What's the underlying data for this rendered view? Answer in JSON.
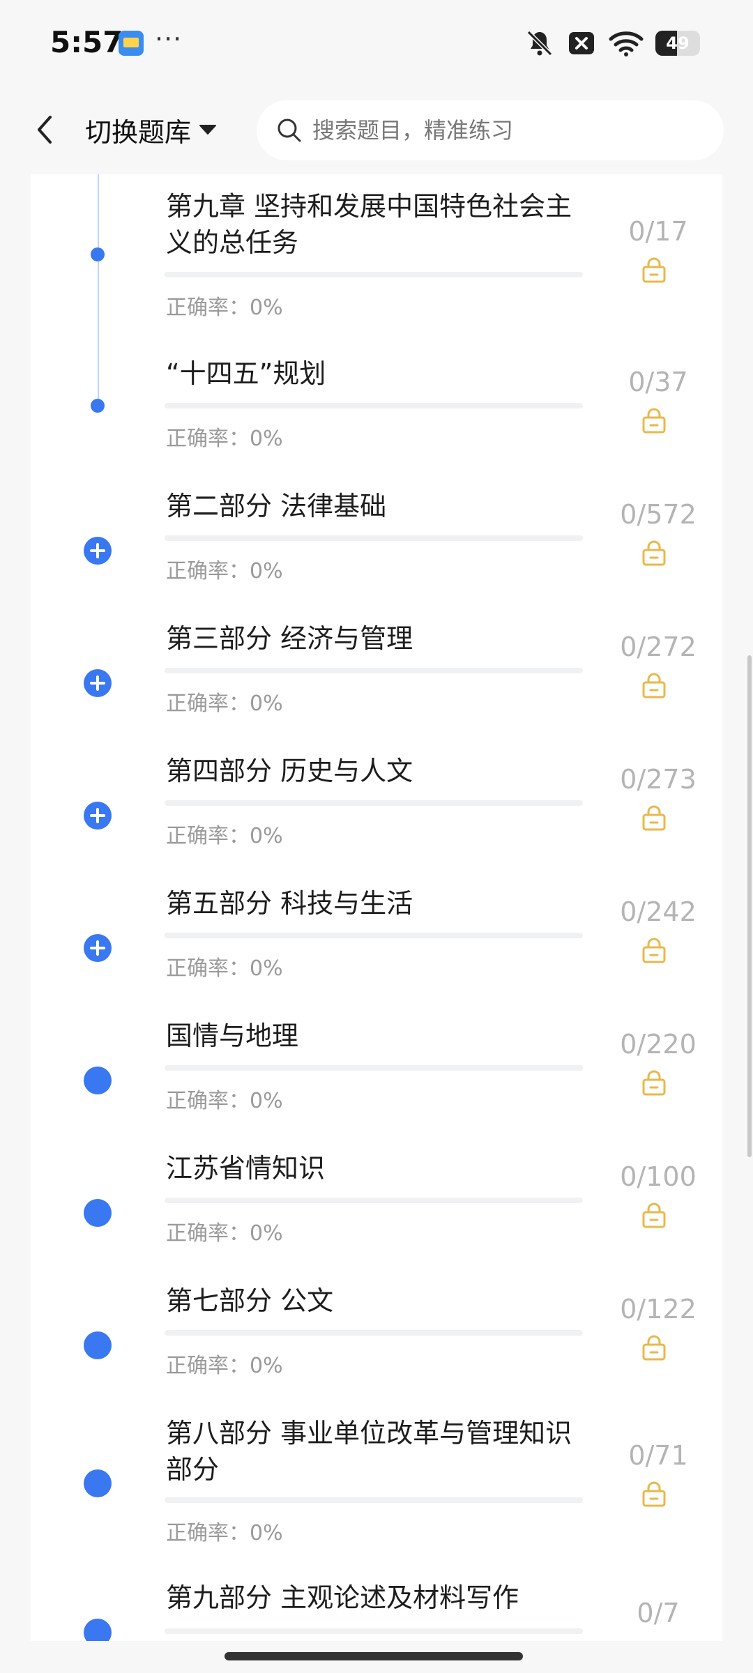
{
  "status_bar": {
    "time": "5:57",
    "more": "···",
    "battery_level": "49"
  },
  "header": {
    "title": "切换题库",
    "search_placeholder": "搜索题目，精准练习"
  },
  "items": [
    {
      "title": "第九章 坚持和发展中国特色社会主义的总任务",
      "accuracy": "正确率：0%",
      "count": "0/17",
      "progress": 0,
      "dot": "small"
    },
    {
      "title": "“十四五”规划",
      "accuracy": "正确率：0%",
      "count": "0/37",
      "progress": 0,
      "dot": "small"
    },
    {
      "title": "第二部分 法律基础",
      "accuracy": "正确率：0%",
      "count": "0/572",
      "progress": 0,
      "dot": "expand"
    },
    {
      "title": "第三部分 经济与管理",
      "accuracy": "正确率：0%",
      "count": "0/272",
      "progress": 0,
      "dot": "expand"
    },
    {
      "title": "第四部分 历史与人文",
      "accuracy": "正确率：0%",
      "count": "0/273",
      "progress": 0,
      "dot": "expand"
    },
    {
      "title": "第五部分 科技与生活",
      "accuracy": "正确率：0%",
      "count": "0/242",
      "progress": 0,
      "dot": "expand"
    },
    {
      "title": "国情与地理",
      "accuracy": "正确率：0%",
      "count": "0/220",
      "progress": 0,
      "dot": "large"
    },
    {
      "title": "江苏省情知识",
      "accuracy": "正确率：0%",
      "count": "0/100",
      "progress": 0,
      "dot": "large"
    },
    {
      "title": "第七部分 公文",
      "accuracy": "正确率：0%",
      "count": "0/122",
      "progress": 0,
      "dot": "large"
    },
    {
      "title": "第八部分 事业单位改革与管理知识部分",
      "accuracy": "正确率：0%",
      "count": "0/71",
      "progress": 0,
      "dot": "large"
    },
    {
      "title": "第九部分 主观论述及材料写作",
      "accuracy": "",
      "count": "0/7",
      "progress": 0,
      "dot": "large"
    }
  ],
  "colors": {
    "accent": "#3978f0",
    "lock": "#e8b84a",
    "muted": "#9a9a9a"
  },
  "icons": {
    "back": "chevron-left-icon",
    "dropdown": "caret-down-icon",
    "search": "search-icon",
    "lock": "lock-icon",
    "expand": "plus-circle-icon"
  }
}
